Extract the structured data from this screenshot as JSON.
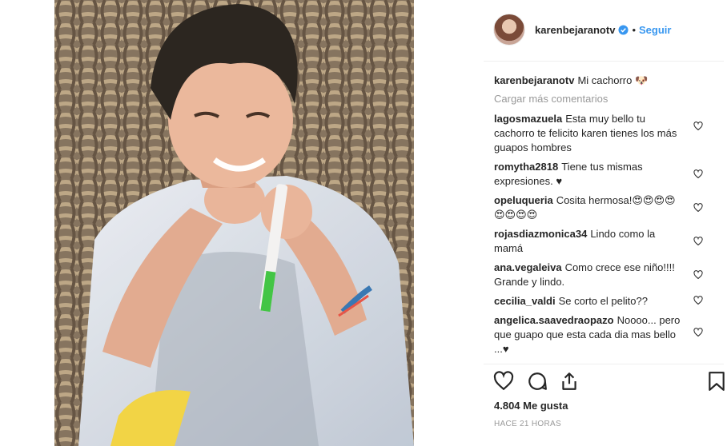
{
  "post": {
    "username": "karenbejaranotv",
    "follow_label": "Seguir",
    "separator": "•",
    "caption_user": "karenbejaranotv",
    "caption_text": "Mi cachorro 🐶",
    "load_more": "Cargar más comentarios",
    "likes": "4.804 Me gusta",
    "time": "HACE 21 HORAS"
  },
  "comments": [
    {
      "user": "lagosmazuela",
      "text": "Esta muy bello tu cachorro te felicito karen tienes los más guapos hombres"
    },
    {
      "user": "romytha2818",
      "text": "Tiene tus mismas expresiones. ♥"
    },
    {
      "user": "opeluqueria",
      "text": "Cosita hermosa!😍😍😍😍😍😍😍😍"
    },
    {
      "user": "rojasdiazmonica34",
      "text": "Lindo como la mamá"
    },
    {
      "user": "ana.vegaleiva",
      "text": "Como crece ese niño!!!! Grande y lindo."
    },
    {
      "user": "cecilia_valdi",
      "text": "Se corto el pelito??"
    },
    {
      "user": "angelica.saavedraopazo",
      "text": "Noooo... pero que guapo que esta cada dia mas bello ...♥"
    }
  ],
  "icons": {
    "verified": "verified-badge-icon",
    "like": "heart-icon",
    "comment": "comment-icon",
    "share": "share-icon",
    "save": "bookmark-icon"
  },
  "colors": {
    "link": "#3897f0",
    "muted": "#999999",
    "text": "#262626"
  }
}
